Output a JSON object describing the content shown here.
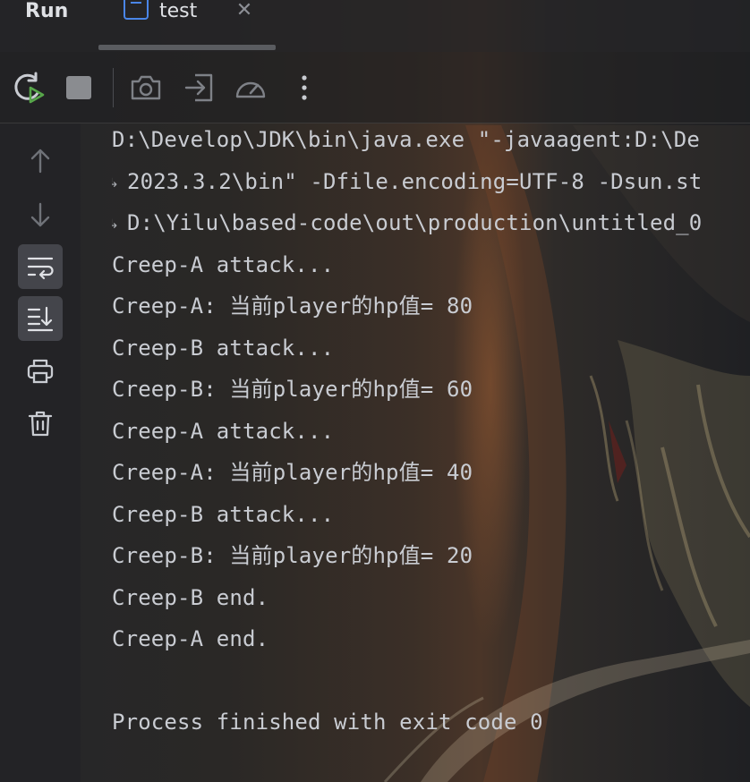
{
  "tab_bar": {
    "panel_title": "Run",
    "tabs": [
      {
        "label": "test",
        "icon": "java-file-icon",
        "close_glyph": "✕"
      }
    ]
  },
  "toolbar": {
    "buttons": [
      {
        "name": "rerun-button",
        "icon": "rerun-icon"
      },
      {
        "name": "stop-button",
        "icon": "stop-icon"
      },
      {
        "name": "screenshot-button",
        "icon": "camera-icon"
      },
      {
        "name": "exit-button",
        "icon": "login-arrow-icon"
      },
      {
        "name": "profiler-button",
        "icon": "gauge-icon"
      },
      {
        "name": "more-button",
        "icon": "kebab-menu-icon"
      }
    ]
  },
  "gutter": {
    "buttons": [
      {
        "name": "up-button",
        "icon": "arrow-up-icon",
        "active": false
      },
      {
        "name": "down-button",
        "icon": "arrow-down-icon",
        "active": false
      },
      {
        "name": "soft-wrap-button",
        "icon": "soft-wrap-icon",
        "active": true
      },
      {
        "name": "scroll-to-end-button",
        "icon": "scroll-to-end-icon",
        "active": true
      },
      {
        "name": "print-button",
        "icon": "printer-icon",
        "active": false
      },
      {
        "name": "clear-button",
        "icon": "trash-icon",
        "active": false
      }
    ]
  },
  "console": {
    "lines": [
      {
        "text": "D:\\Develop\\JDK\\bin\\java.exe \"-javaagent:D:\\De",
        "wrapped": false
      },
      {
        "text": "2023.3.2\\bin\" -Dfile.encoding=UTF-8 -Dsun.st",
        "wrapped": true
      },
      {
        "text": "D:\\Yilu\\based-code\\out\\production\\untitled_0",
        "wrapped": true
      },
      {
        "text": "Creep-A attack...",
        "wrapped": false
      },
      {
        "text": "Creep-A: 当前player的hp值= 80",
        "wrapped": false
      },
      {
        "text": "Creep-B attack...",
        "wrapped": false
      },
      {
        "text": "Creep-B: 当前player的hp值= 60",
        "wrapped": false
      },
      {
        "text": "Creep-A attack...",
        "wrapped": false
      },
      {
        "text": "Creep-A: 当前player的hp值= 40",
        "wrapped": false
      },
      {
        "text": "Creep-B attack...",
        "wrapped": false
      },
      {
        "text": "Creep-B: 当前player的hp值= 20",
        "wrapped": false
      },
      {
        "text": "Creep-B end.",
        "wrapped": false
      },
      {
        "text": "Creep-A end.",
        "wrapped": false
      },
      {
        "text": "",
        "wrapped": false
      },
      {
        "text": "Process finished with exit code 0",
        "wrapped": false
      }
    ],
    "wrap_glyph": "↳"
  },
  "colors": {
    "text": "#c9ccd2",
    "accent_green": "#57a64a",
    "file_icon_blue": "#4a86e8"
  }
}
